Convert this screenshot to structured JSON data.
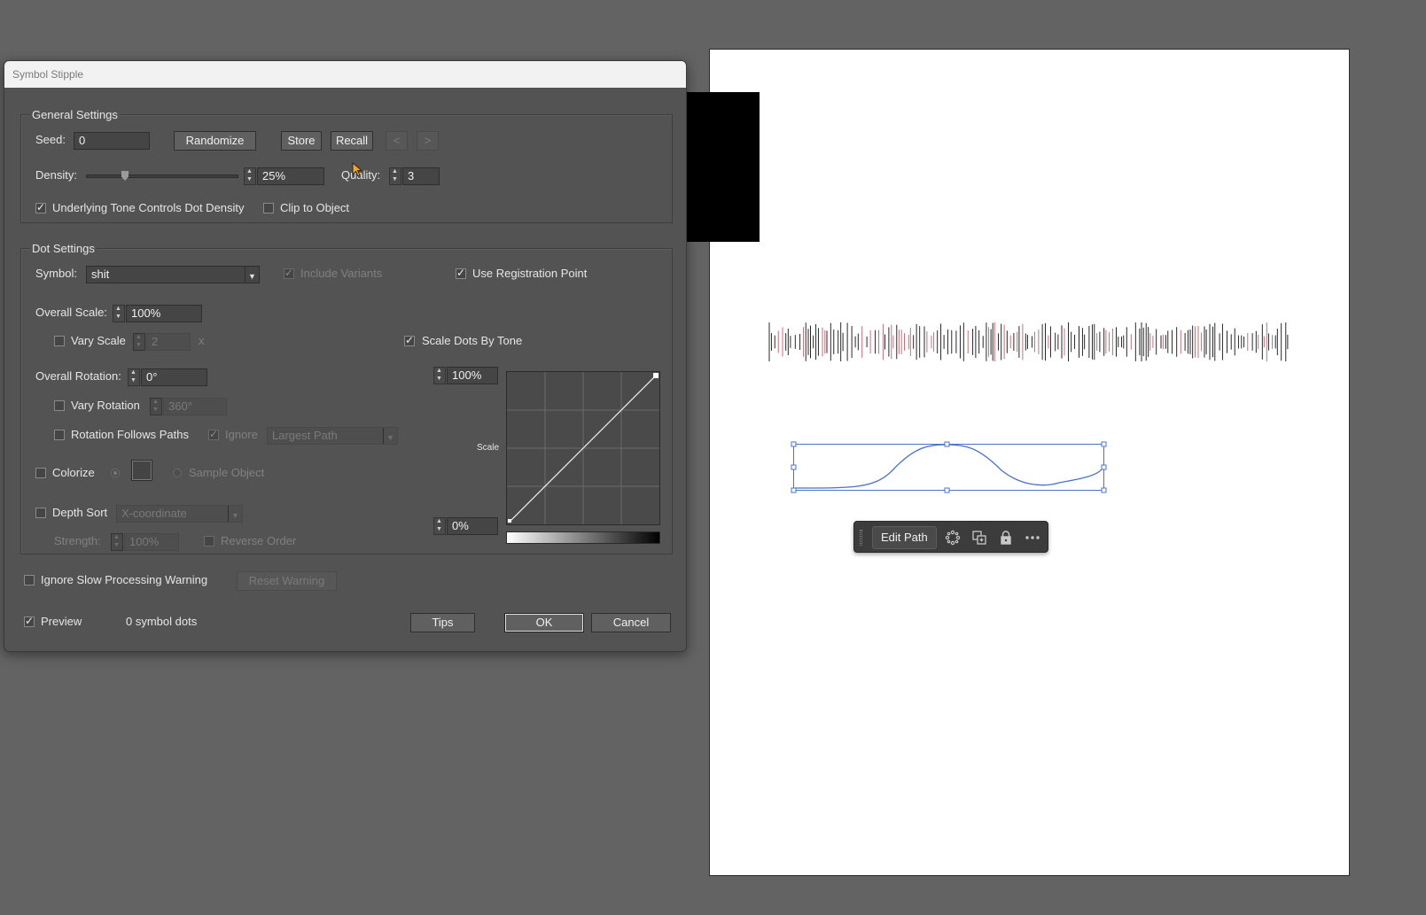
{
  "dialog": {
    "title": "Symbol Stipple",
    "general": {
      "group_title": "General Settings",
      "seed_label": "Seed:",
      "seed_value": "0",
      "randomize_label": "Randomize",
      "store_label": "Store",
      "recall_label": "Recall",
      "prev_label": "<",
      "next_label": ">",
      "density_label": "Density:",
      "density_value": "25%",
      "density_fraction": 0.25,
      "quality_label": "Quality:",
      "quality_value": "3",
      "tone_density_label": "Underlying Tone Controls Dot Density",
      "tone_density_checked": true,
      "clip_label": "Clip to Object",
      "clip_checked": false
    },
    "dot": {
      "group_title": "Dot Settings",
      "symbol_label": "Symbol:",
      "symbol_value": "shit",
      "include_variants_label": "Include Variants",
      "use_reg_point_label": "Use Registration Point",
      "overall_scale_label": "Overall Scale:",
      "overall_scale_value": "100%",
      "vary_scale_label": "Vary Scale",
      "vary_scale_value": "2",
      "vary_scale_unit": "x",
      "scale_by_tone_label": "Scale Dots By Tone",
      "overall_rotation_label": "Overall Rotation:",
      "overall_rotation_value": "0°",
      "vary_rotation_label": "Vary Rotation",
      "vary_rotation_value": "360°",
      "rotation_follows_label": "Rotation Follows Paths",
      "ignore_label": "Ignore",
      "largest_path_value": "Largest Path",
      "colorize_label": "Colorize",
      "sample_object_label": "Sample Object",
      "depth_sort_label": "Depth Sort",
      "depth_sort_value": "X-coordinate",
      "strength_label": "Strength:",
      "strength_value": "100%",
      "reverse_order_label": "Reverse Order",
      "curve_top_value": "100%",
      "curve_bottom_value": "0%",
      "curve_axis_label": "Scale"
    },
    "footer": {
      "ignore_slow_label": "Ignore Slow Processing Warning",
      "reset_warning_label": "Reset Warning",
      "preview_label": "Preview",
      "dot_count": "0 symbol dots",
      "tips_label": "Tips",
      "ok_label": "OK",
      "cancel_label": "Cancel"
    }
  },
  "context_bar": {
    "edit_path_label": "Edit Path",
    "icons": [
      "transform-icon",
      "duplicate-icon",
      "lock-icon",
      "more-icon"
    ]
  },
  "colors": {
    "canvas": "#636363",
    "panel": "#535353",
    "selection": "#4a72c9",
    "stipple_black": "#111111",
    "stipple_red": "#c0606a"
  }
}
